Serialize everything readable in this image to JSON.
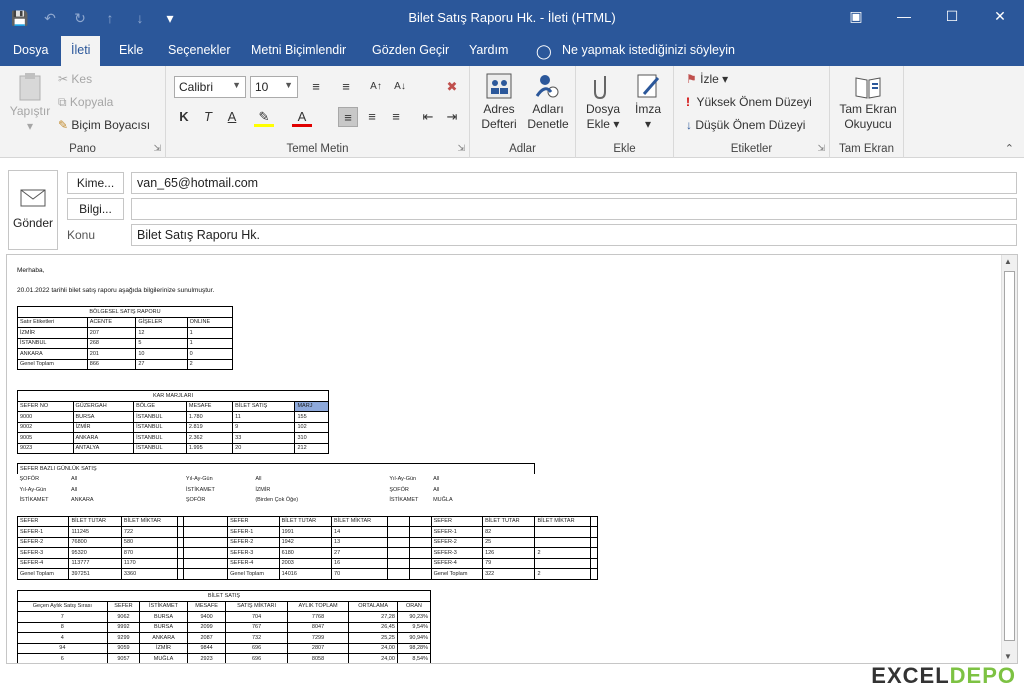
{
  "window": {
    "title": "Bilet Satış Raporu Hk.  -  İleti (HTML)"
  },
  "tabs": [
    "Dosya",
    "İleti",
    "Ekle",
    "Seçenekler",
    "Metni Biçimlendir",
    "Gözden Geçir",
    "Yardım"
  ],
  "tellme": "Ne yapmak istediğinizi söyleyin",
  "ribbon": {
    "pano": {
      "label": "Pano",
      "paste": "Yapıştır",
      "cut": "Kes",
      "copy": "Kopyala",
      "painter": "Biçim Boyacısı"
    },
    "temel": {
      "label": "Temel Metin",
      "font": "Calibri",
      "size": "10"
    },
    "adlar": {
      "label": "Adlar",
      "book1": "Adres",
      "book2": "Defteri",
      "check1": "Adları",
      "check2": "Denetle"
    },
    "ekle": {
      "label": "Ekle",
      "file1": "Dosya",
      "file2": "Ekle",
      "sig": "İmza"
    },
    "etiketler": {
      "label": "Etiketler",
      "follow": "İzle",
      "high": "Yüksek Önem Düzeyi",
      "low": "Düşük Önem Düzeyi"
    },
    "tam": {
      "label": "Tam Ekran",
      "read1": "Tam Ekran",
      "read2": "Okuyucu"
    }
  },
  "compose": {
    "send": "Gönder",
    "to_btn": "Kime...",
    "to_value": "van_65@hotmail.com",
    "cc_btn": "Bilgi...",
    "cc_value": "",
    "subject_label": "Konu",
    "subject": "Bilet Satış Raporu Hk."
  },
  "mail": {
    "greeting": "Merhaba,",
    "intro": "20.01.2022 tarihli bilet satış raporu aşağıda bilgilerinize sunulmuştur.",
    "t1": {
      "title": "BÖLGESEL SATIŞ RAPORU",
      "headers": [
        "Satır Etiketleri",
        "ACENTE",
        "GİŞELER",
        "ONLINE"
      ],
      "rows": [
        [
          "İZMİR",
          "207",
          "12",
          "1"
        ],
        [
          "İSTANBUL",
          "268",
          "5",
          "1"
        ],
        [
          "ANKARA",
          "201",
          "10",
          "0"
        ],
        [
          "Genel Toplam",
          "866",
          "27",
          "2"
        ]
      ]
    },
    "t2": {
      "title": "KAR MARJLARI",
      "headers": [
        "SEFER NO",
        "GÜZERGAH",
        "BÖLGE",
        "MESAFE",
        "BİLET SATIŞ",
        "MARJ"
      ],
      "rows": [
        [
          "9000",
          "BURSA",
          "İSTANBUL",
          "1.780",
          "11",
          "155"
        ],
        [
          "9002",
          "İZMİR",
          "İSTANBUL",
          "2.819",
          "9",
          "102"
        ],
        [
          "9005",
          "ANKARA",
          "İSTANBUL",
          "2.362",
          "33",
          "310"
        ],
        [
          "9023",
          "ANTALYA",
          "İSTANBUL",
          "1.995",
          "20",
          "212"
        ]
      ]
    },
    "t3": {
      "title": "SEFER BAZLI GÜNLÜK SATIŞ",
      "filters": [
        [
          "ŞOFÖR",
          "All",
          "Yıl-Ay-Gün",
          "All",
          "Yıl-Ay-Gün",
          "All"
        ],
        [
          "Yıl-Ay-Gün",
          "All",
          "İSTİKAMET",
          "İZMİR",
          "ŞOFÖR",
          "All"
        ],
        [
          "İSTİKAMET",
          "ANKARA",
          "ŞOFÖR",
          "(Birden Çok Öğe)",
          "İSTİKAMET",
          "MUĞLA"
        ]
      ],
      "headers": [
        "SEFER",
        "BİLET TUTAR",
        "BİLET MİKTAR"
      ],
      "left": [
        [
          "SEFER-1",
          "111245",
          "722"
        ],
        [
          "SEFER-2",
          "76800",
          "580"
        ],
        [
          "SEFER-3",
          "95320",
          "870"
        ],
        [
          "SEFER-4",
          "113777",
          "1170"
        ],
        [
          "Genel Toplam",
          "397251",
          "3360"
        ]
      ],
      "mid": [
        [
          "SEFER-1",
          "1991",
          "14"
        ],
        [
          "SEFER-2",
          "1942",
          "13"
        ],
        [
          "SEFER-3",
          "6180",
          "27"
        ],
        [
          "SEFER-4",
          "2003",
          "16"
        ],
        [
          "Genel Toplam",
          "14016",
          "70"
        ]
      ],
      "right": [
        [
          "SEFER-1",
          "82",
          ""
        ],
        [
          "SEFER-2",
          "25",
          ""
        ],
        [
          "SEFER-3",
          "126",
          "2"
        ],
        [
          "SEFER-4",
          "79",
          ""
        ],
        [
          "Genel Toplam",
          "322",
          "2"
        ]
      ]
    },
    "t4": {
      "title": "BİLET SATIŞ",
      "headers": [
        "Geçen Aylık Satış Sırası",
        "SEFER",
        "İSTİKAMET",
        "MESAFE",
        "SATIŞ MİKTARI",
        "AYLIK TOPLAM",
        "ORTALAMA",
        "ORAN"
      ],
      "rows": [
        [
          "7",
          "9062",
          "BURSA",
          "9400",
          "704",
          "7768",
          "27,28",
          "90,23%"
        ],
        [
          "8",
          "9992",
          "BURSA",
          "2099",
          "767",
          "8047",
          "26,45",
          "9,54%"
        ],
        [
          "4",
          "9299",
          "ANKARA",
          "2087",
          "732",
          "7299",
          "25,25",
          "90,94%"
        ],
        [
          "94",
          "9059",
          "İZMİR",
          "9844",
          "696",
          "2807",
          "24,00",
          "98,28%"
        ],
        [
          "6",
          "9057",
          "MUĞLA",
          "2923",
          "696",
          "8058",
          "24,00",
          "8,54%"
        ]
      ]
    }
  },
  "watermark": {
    "a": "EXCEL",
    "b": "DEPO"
  }
}
